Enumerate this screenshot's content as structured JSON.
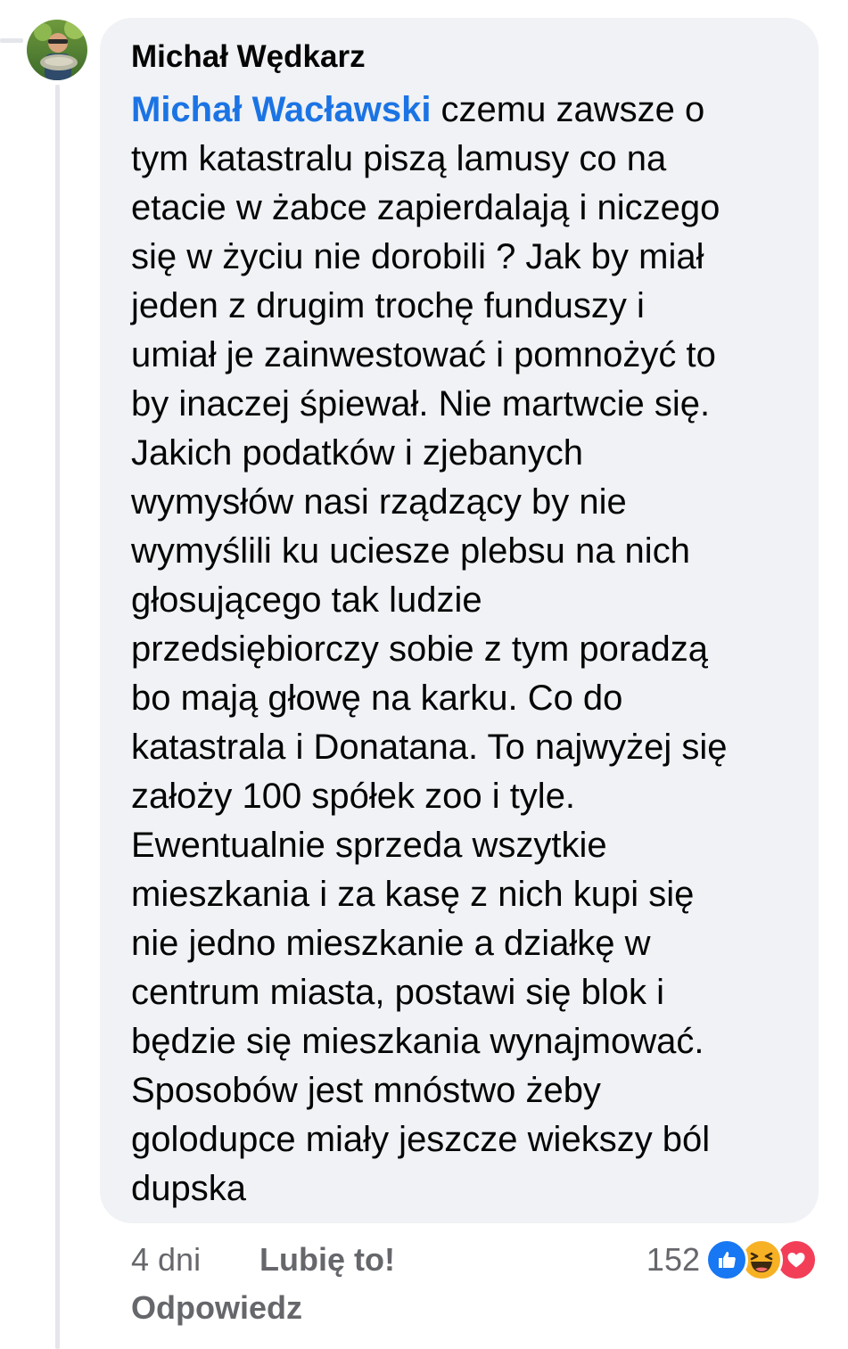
{
  "comment": {
    "author": "Michał Wędkarz",
    "mention": "Michał Wacławski",
    "text": " czemu zawsze o\ntym katastralu piszą lamusy co na\netacie w żabce zapierdalają i niczego\nsię w życiu nie dorobili ? Jak by miał\njeden z drugim trochę funduszy i\numiał je zainwestować i pomnożyć to\nby inaczej śpiewał. Nie martwcie się.\nJakich podatków i zjebanych\nwymysłów nasi rządzący by nie\nwymyślili ku uciesze plebsu na nich\ngłosującego tak ludzie\nprzedsiębiorczy sobie z tym poradzą\nbo mają głowę na karku. Co do\nkatastrala i Donatana. To najwyżej się\nzałoży 100 spółek zoo i tyle.\nEwentualnie sprzeda wszytkie\nmieszkania i za kasę z nich kupi się\nnie jedno mieszkanie a działkę w\ncentrum miasta, postawi się blok i\nbędzie się mieszkania wynajmować.\nSposobów jest mnóstwo żeby\ngolodupce miały jeszcze wiekszy ból\ndupska"
  },
  "footer": {
    "time": "4 dni",
    "like_label": "Lubię to!",
    "reply_label": "Odpowiedz",
    "reaction_count": "152",
    "reactions": [
      "like-icon",
      "haha-icon",
      "love-icon"
    ]
  },
  "colors": {
    "bubble": "#f0f2f5",
    "mention": "#1b74e4",
    "meta_text": "#65676b",
    "like": "#1877f2",
    "haha": "#f7b125",
    "love": "#f33e58"
  }
}
